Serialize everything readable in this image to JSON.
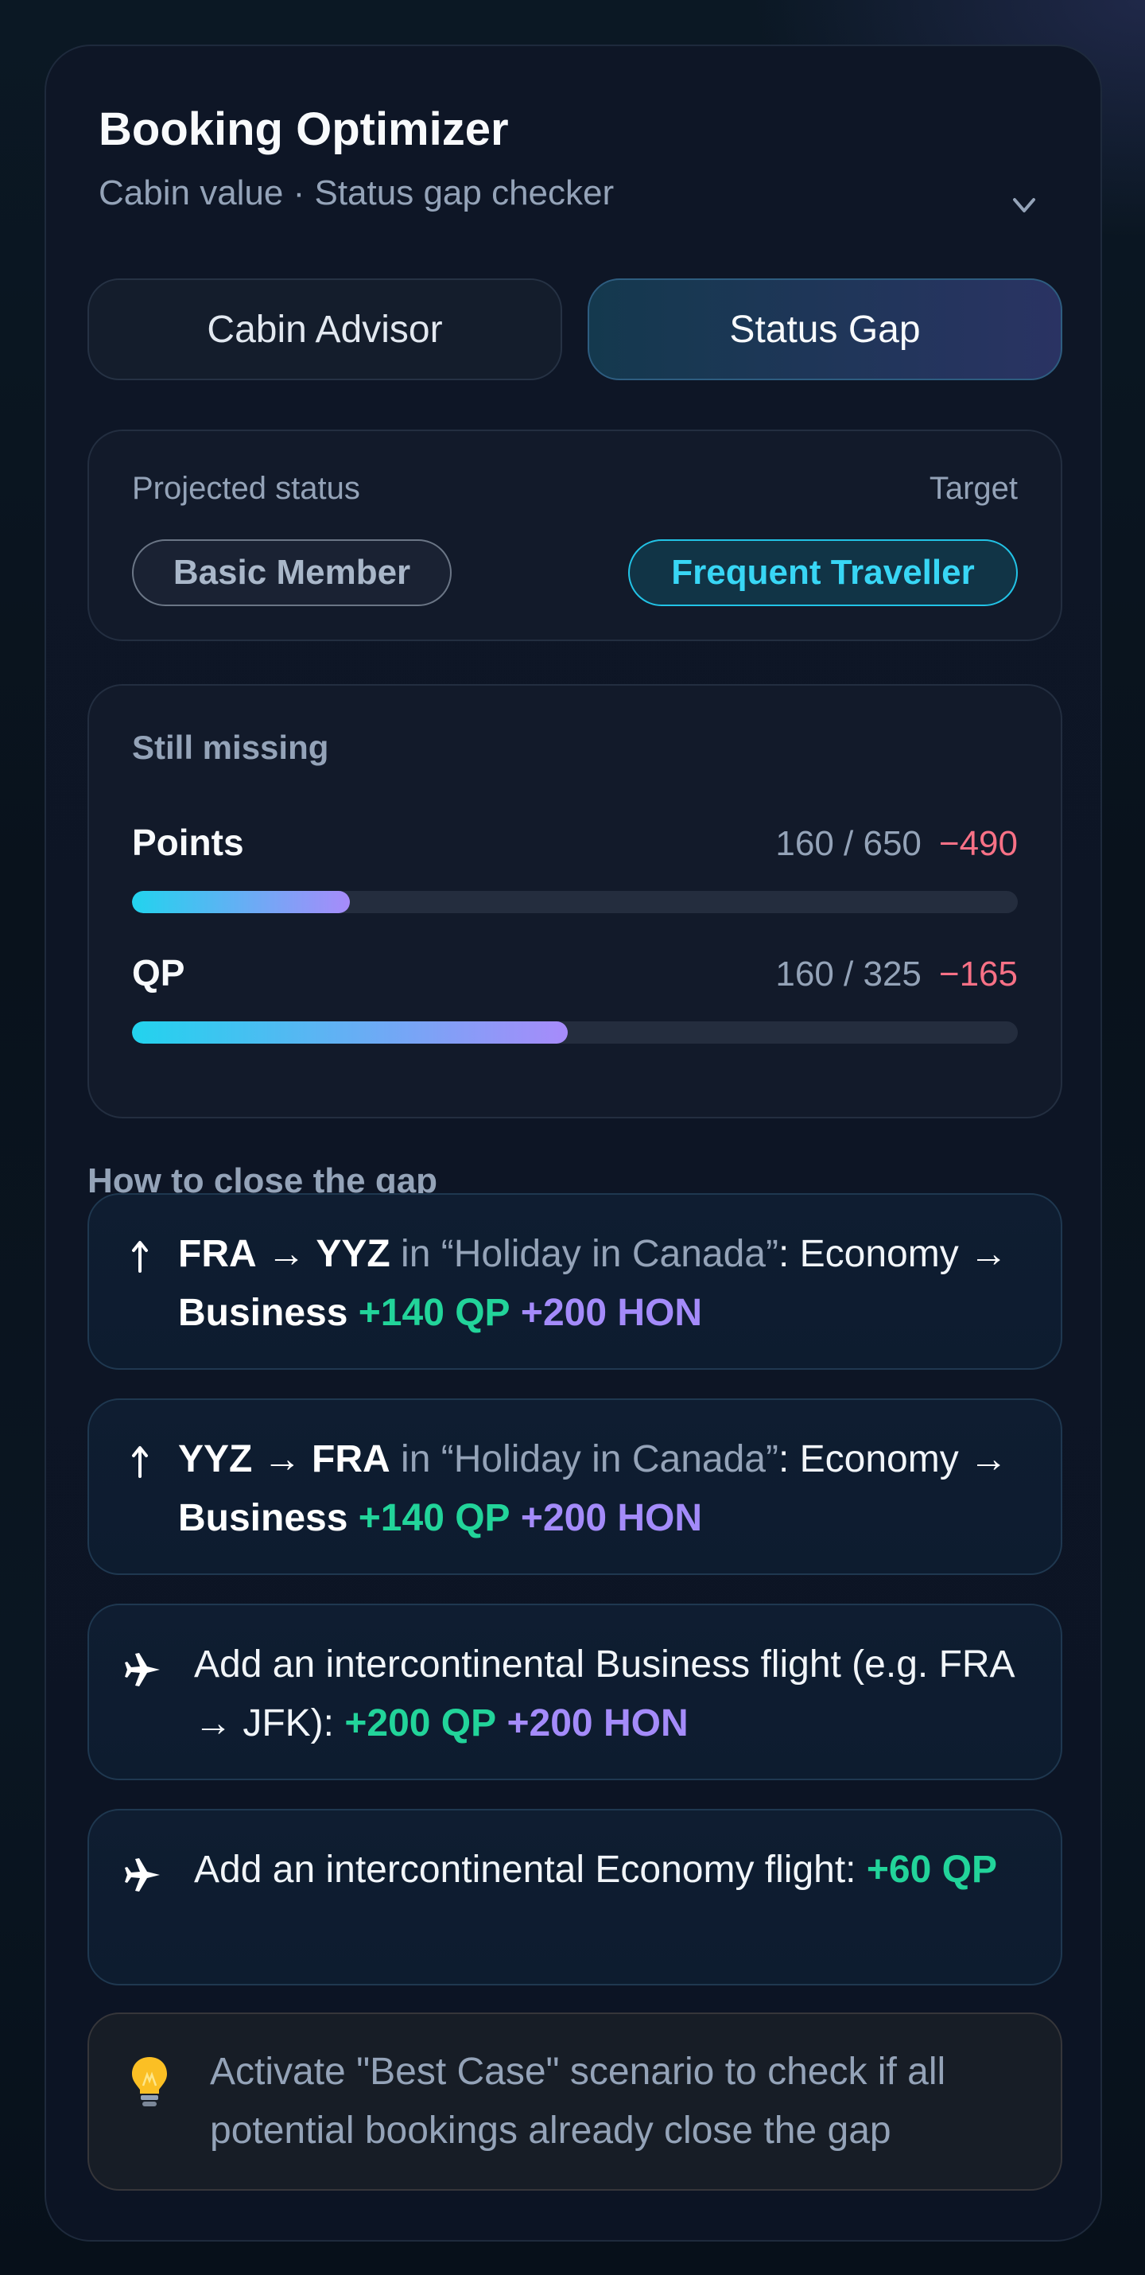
{
  "header": {
    "title": "Booking Optimizer",
    "subtitle": "Cabin value · Status gap checker",
    "collapse_icon": "chevron-down-icon"
  },
  "tabs": [
    {
      "label": "Cabin Advisor",
      "active": false
    },
    {
      "label": "Status Gap",
      "active": true
    }
  ],
  "status": {
    "projected_label": "Projected status",
    "target_label": "Target",
    "projected_value": "Basic Member",
    "target_value": "Frequent Traveller"
  },
  "missing": {
    "title": "Still missing",
    "rows": [
      {
        "label": "Points",
        "current": 160,
        "target": 650,
        "display": "160 / 650",
        "delta": "−490",
        "fill_fraction": 0.246
      },
      {
        "label": "QP",
        "current": 160,
        "target": 325,
        "display": "160 / 325",
        "delta": "−165",
        "fill_fraction": 0.492
      }
    ]
  },
  "gap": {
    "title": "How to close the gap",
    "suggestions": [
      {
        "icon": "arrow-up-icon",
        "from": "FRA",
        "arrow": "→",
        "to": "YYZ",
        "context": "in “Holiday in Canada”",
        "change_prefix": ": Economy",
        "change_arrow": "→",
        "cabin": "Business",
        "qp": "+140 QP",
        "hon": "+200 HON"
      },
      {
        "icon": "arrow-up-icon",
        "from": "YYZ",
        "arrow": "→",
        "to": "FRA",
        "context": "in “Holiday in Canada”",
        "change_prefix": ": Economy",
        "change_arrow": "→",
        "cabin": "Business",
        "qp": "+140 QP",
        "hon": "+200 HON"
      },
      {
        "icon": "airplane-icon",
        "text": "Add an intercontinental Business flight (e.g. FRA → JFK):",
        "qp": "+200 QP",
        "hon": "+200 HON"
      },
      {
        "icon": "airplane-icon",
        "text": "Add an intercontinental Economy flight:",
        "qp": "+60 QP"
      }
    ]
  },
  "tip": {
    "icon": "lightbulb-icon",
    "text": "Activate \"Best Case\" scenario to check if all potential bookings already close the gap"
  }
}
